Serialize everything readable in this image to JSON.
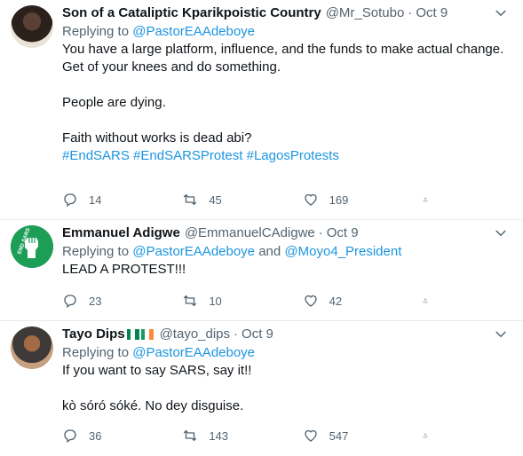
{
  "tweets": [
    {
      "name": "Son of a Cataliptic Kparikpoistic Country",
      "handle": "@Mr_Sotubo",
      "dot": "·",
      "date": "Oct 9",
      "replying_prefix": "Replying to ",
      "replying_to": [
        "@PastorEAAdeboye"
      ],
      "text": "You have a large platform, influence, and the funds to make actual change. Get of your knees and do something.\n\nPeople are dying.\n\nFaith without works is dead abi?\n",
      "hashtags": "#EndSARS #EndSARSProtest #LagosProtests",
      "replies": "14",
      "retweets": "45",
      "likes": "169"
    },
    {
      "name": "Emmanuel Adigwe",
      "handle": "@EmmanuelCAdigwe",
      "dot": "·",
      "date": "Oct 9",
      "replying_prefix": "Replying to ",
      "replying_to": [
        "@PastorEAAdeboye",
        "@Moyo4_President"
      ],
      "replying_joiner": " and ",
      "text": "LEAD A PROTEST!!!",
      "avatar_text": "END SARS",
      "replies": "23",
      "retweets": "10",
      "likes": "42"
    },
    {
      "name": "Tayo Dips",
      "handle": "@tayo_dips",
      "dot": "·",
      "date": "Oct 9",
      "replying_prefix": "Replying to ",
      "replying_to": [
        "@PastorEAAdeboye"
      ],
      "text": "If you want to say SARS, say it!!\n\nkò sóró sóké. No dey disguise.",
      "flags": [
        "nigeria-flag",
        "ireland-flag"
      ],
      "replies": "36",
      "retweets": "143",
      "likes": "547"
    }
  ],
  "icons": {
    "reply": "reply-icon",
    "retweet": "retweet-icon",
    "like": "like-icon",
    "share": "share-icon",
    "more": "chevron-down-icon"
  },
  "colors": {
    "link": "#1b95e0",
    "secondary_text": "#536471",
    "divider": "#e6ecf0",
    "nigeria_green": "#008751",
    "ireland_orange": "#ff883e"
  }
}
